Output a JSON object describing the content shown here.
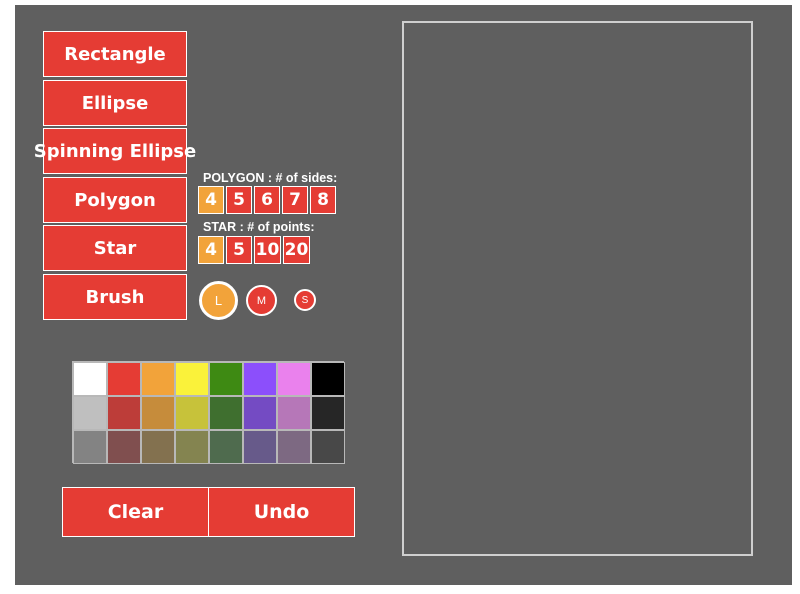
{
  "tools": [
    {
      "label": "Rectangle"
    },
    {
      "label": "Ellipse"
    },
    {
      "label": "Spinning Ellipse"
    },
    {
      "label": "Polygon"
    },
    {
      "label": "Star"
    },
    {
      "label": "Brush"
    }
  ],
  "polygon": {
    "label": "POLYGON : # of sides:",
    "options": [
      "4",
      "5",
      "6",
      "7",
      "8"
    ],
    "selected": "4"
  },
  "star": {
    "label": "STAR : # of points:",
    "options": [
      "4",
      "5",
      "10",
      "20"
    ],
    "selected": "4"
  },
  "brush_sizes": [
    {
      "label": "L",
      "selected": true
    },
    {
      "label": "M",
      "selected": false
    },
    {
      "label": "S",
      "selected": false
    }
  ],
  "palette": [
    [
      "#ffffff",
      "#e53c34",
      "#f2a33a",
      "#faf23a",
      "#3e8a13",
      "#8c4ffb",
      "#ea81ed",
      "#000000"
    ],
    [
      "#bfbfbf",
      "#bd3d39",
      "#c68c3b",
      "#c7c23a",
      "#3f6f2f",
      "#744bc3",
      "#b677b8",
      "#262626"
    ],
    [
      "#838383",
      "#804f4f",
      "#83714f",
      "#848450",
      "#4f6b4e",
      "#675a8a",
      "#7d6982",
      "#484848"
    ]
  ],
  "actions": {
    "clear_label": "Clear",
    "undo_label": "Undo"
  },
  "colors": {
    "background": "#5f5f5f",
    "button": "#e53c34",
    "selected": "#f2a33a"
  }
}
